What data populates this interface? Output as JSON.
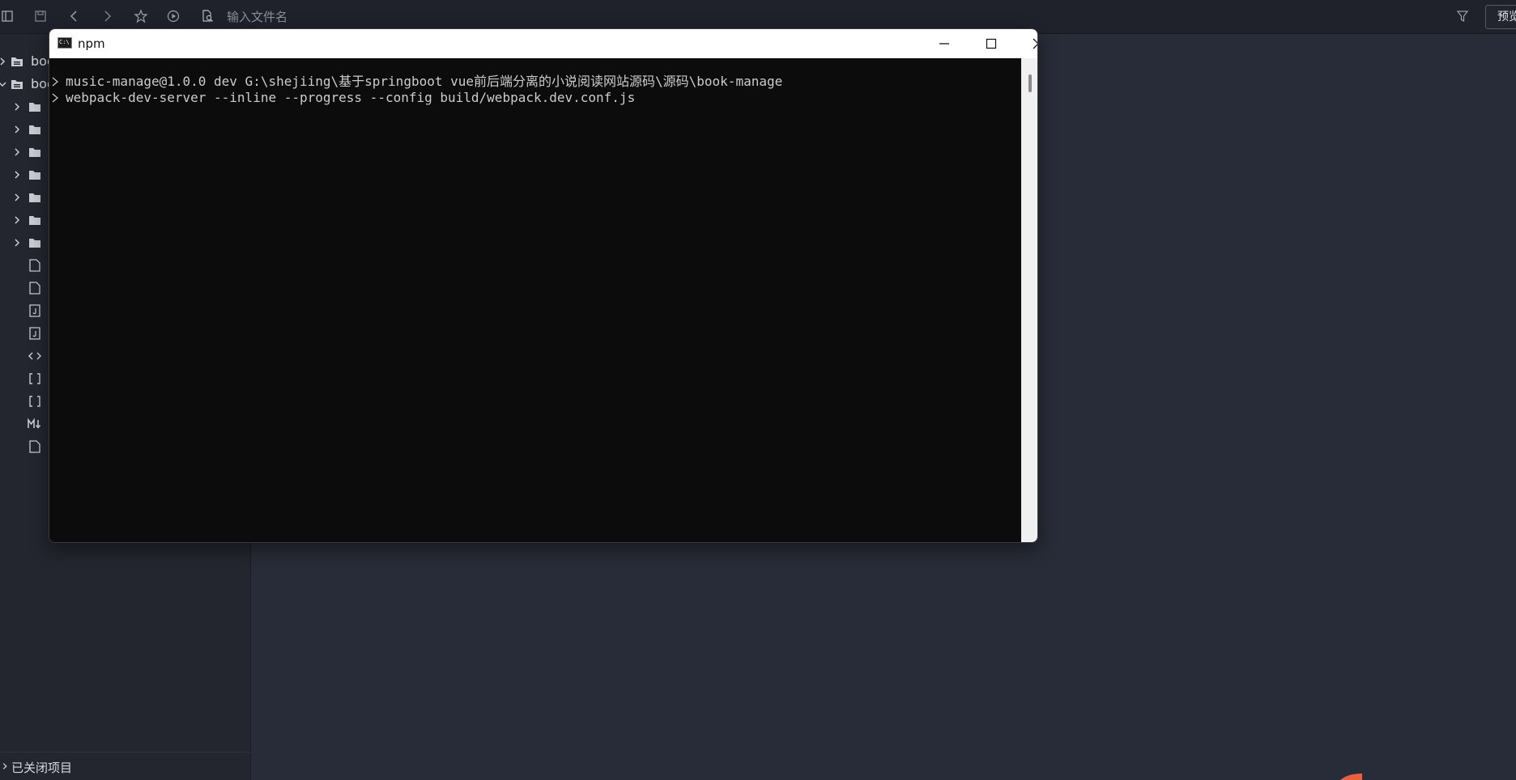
{
  "toolbar": {
    "search_placeholder": "输入文件名",
    "preview_label": "预览"
  },
  "sidebar": {
    "projects": [
      {
        "label": "boo"
      },
      {
        "label": "boo"
      }
    ],
    "footer_label": "已关闭项目"
  },
  "terminal": {
    "title": "npm",
    "app_icon_text": "C:\\",
    "lines": [
      "music-manage@1.0.0 dev G:\\shejiing\\基于springboot vue前后端分离的小说阅读网站源码\\源码\\book-manage",
      "webpack-dev-server --inline --progress --config build/webpack.dev.conf.js"
    ]
  },
  "colors": {
    "app_bg": "#282c38",
    "toolbar_bg": "#1f222b",
    "sidebar_bg": "#23262f",
    "terminal_bg": "#0c0c0c",
    "terminal_text": "#cccccc",
    "accent_orange": "#e8603c"
  }
}
